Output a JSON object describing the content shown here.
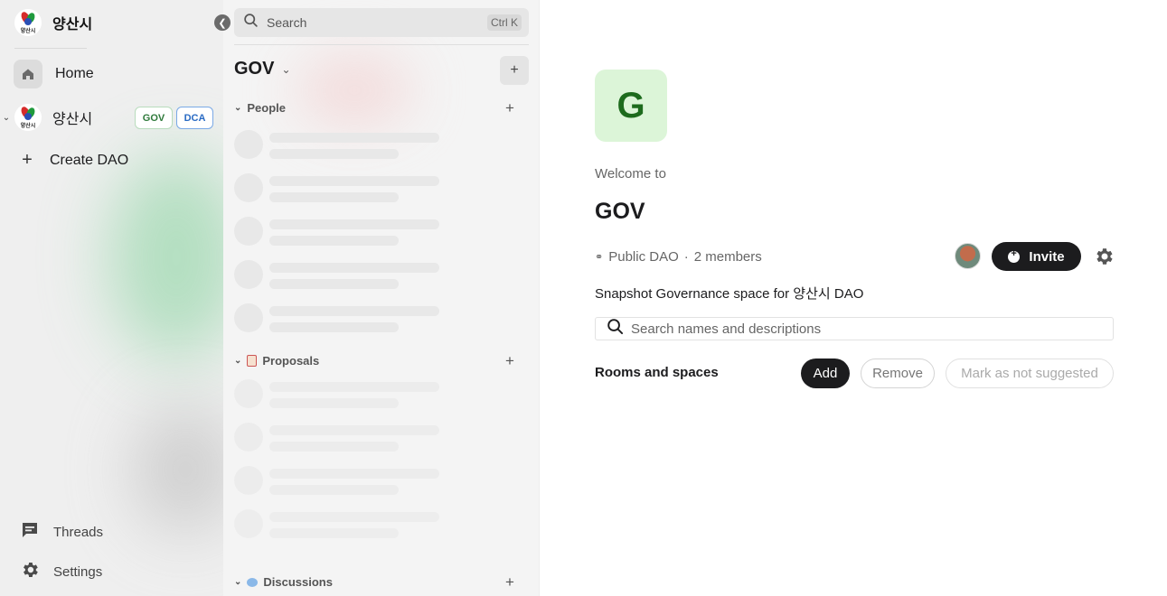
{
  "sidebar": {
    "org_name": "양산시",
    "logo_text": "양산시",
    "home_label": "Home",
    "dao": {
      "name": "양산시",
      "chips": [
        "GOV",
        "DCA"
      ]
    },
    "create_dao_label": "Create DAO",
    "threads_label": "Threads",
    "settings_label": "Settings"
  },
  "middle": {
    "search_placeholder": "Search",
    "search_shortcut": "Ctrl K",
    "space_title": "GOV",
    "sections": {
      "people": "People",
      "proposals": "Proposals",
      "discussions": "Discussions"
    }
  },
  "main": {
    "avatar_letter": "G",
    "welcome": "Welcome to",
    "title": "GOV",
    "visibility": "Public DAO",
    "separator": "·",
    "members": "2 members",
    "invite_label": "Invite",
    "description": "Snapshot Governance space for 양산시 DAO",
    "search_placeholder": "Search names and descriptions",
    "rooms_label": "Rooms and spaces",
    "buttons": {
      "add": "Add",
      "remove": "Remove",
      "mark": "Mark as not suggested"
    }
  },
  "icons": {
    "home": "home-icon",
    "threads": "threads-icon",
    "settings": "gear-icon",
    "search": "search-icon",
    "collapse": "chevron-left-icon"
  },
  "colors": {
    "accent_dark": "#1c1c1e",
    "gov_chip": "#2f7a3b",
    "dca_chip": "#2a6bc4",
    "space_avatar_bg": "#dcf5d8"
  }
}
